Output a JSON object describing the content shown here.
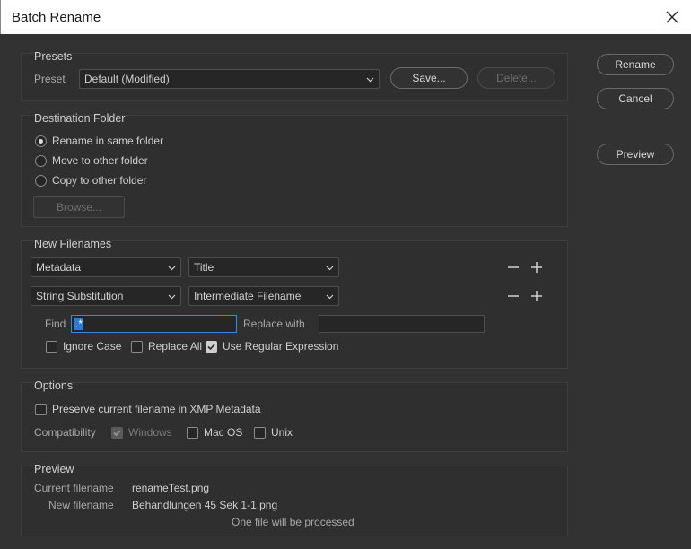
{
  "window": {
    "title": "Batch Rename"
  },
  "presets": {
    "group_label": "Presets",
    "preset_label": "Preset",
    "preset_value": "Default (Modified)",
    "save_label": "Save...",
    "delete_label": "Delete..."
  },
  "destination": {
    "group_label": "Destination Folder",
    "options": [
      {
        "label": "Rename in same folder",
        "selected": true
      },
      {
        "label": "Move to other folder",
        "selected": false
      },
      {
        "label": "Copy to other folder",
        "selected": false
      }
    ],
    "browse_label": "Browse..."
  },
  "new_filenames": {
    "group_label": "New Filenames",
    "rows": [
      {
        "type": "Metadata",
        "value": "Title"
      },
      {
        "type": "String Substitution",
        "value": "Intermediate Filename"
      }
    ],
    "find_label": "Find",
    "find_value": ".*",
    "replace_label": "Replace with",
    "replace_value": "",
    "ignore_case_label": "Ignore Case",
    "ignore_case": false,
    "replace_all_label": "Replace All",
    "replace_all": false,
    "regex_label": "Use Regular Expression",
    "regex": true
  },
  "options": {
    "group_label": "Options",
    "preserve_label": "Preserve current filename in XMP Metadata",
    "preserve": false,
    "compat_label": "Compatibility",
    "windows_label": "Windows",
    "windows": true,
    "macos_label": "Mac OS",
    "macos": false,
    "unix_label": "Unix",
    "unix": false
  },
  "preview": {
    "group_label": "Preview",
    "current_label": "Current filename",
    "current_value": "renameTest.png",
    "new_label": "New filename",
    "new_value": "Behandlungen 45 Sek 1-1.png",
    "summary": "One file will be processed"
  },
  "actions": {
    "rename_label": "Rename",
    "cancel_label": "Cancel",
    "preview_label": "Preview"
  }
}
